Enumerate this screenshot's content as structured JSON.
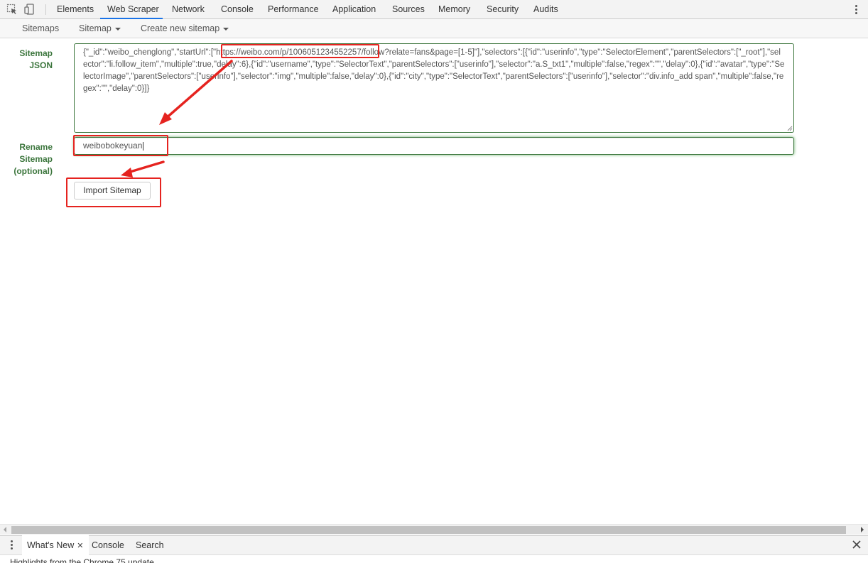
{
  "devtools": {
    "tabs": [
      "Elements",
      "Web Scraper",
      "Network",
      "Console",
      "Performance",
      "Application",
      "Sources",
      "Memory",
      "Security",
      "Audits"
    ],
    "active_tab": "Web Scraper"
  },
  "scraper_nav": {
    "sitemaps": "Sitemaps",
    "sitemap": "Sitemap",
    "create_new": "Create new sitemap"
  },
  "form": {
    "json_label_line1": "Sitemap",
    "json_label_line2": "JSON",
    "json_prefix": "{\"_id\":\"weibo_chenglong\",\"startUrl\":[\"",
    "json_url": "https://weibo.com/p/1006051234552257/",
    "json_rest": "follow?relate=fans&page=[1-5]\"],\"selectors\":[{\"id\":\"userinfo\",\"type\":\"SelectorElement\",\"parentSelectors\":[\"_root\"],\"selector\":\"li.follow_item\",\"multiple\":true,\"delay\":6},{\"id\":\"username\",\"type\":\"SelectorText\",\"parentSelectors\":[\"userinfo\"],\"selector\":\"a.S_txt1\",\"multiple\":false,\"regex\":\"\",\"delay\":0},{\"id\":\"avatar\",\"type\":\"SelectorImage\",\"parentSelectors\":[\"userinfo\"],\"selector\":\"img\",\"multiple\":false,\"delay\":0},{\"id\":\"city\",\"type\":\"SelectorText\",\"parentSelectors\":[\"userinfo\"],\"selector\":\"div.info_add span\",\"multiple\":false,\"regex\":\"\",\"delay\":0}]}",
    "rename_label_line1": "Rename",
    "rename_label_line2": "Sitemap",
    "rename_label_line3": "(optional)",
    "rename_value": "weibobokeyuan",
    "import_button": "Import Sitemap"
  },
  "drawer": {
    "tabs": [
      "What's New",
      "Console",
      "Search"
    ],
    "active_tab": "What's New",
    "content_text": "Highlights from the Chrome 75 update"
  },
  "colors": {
    "label_green": "#3c763d",
    "annotation_red": "#e5231f",
    "active_tab_underline": "#1a73e8"
  },
  "icons": [
    "inspect-element-icon",
    "device-toolbar-icon",
    "more-options-icon",
    "close-icon",
    "dropdown-caret-icon"
  ]
}
